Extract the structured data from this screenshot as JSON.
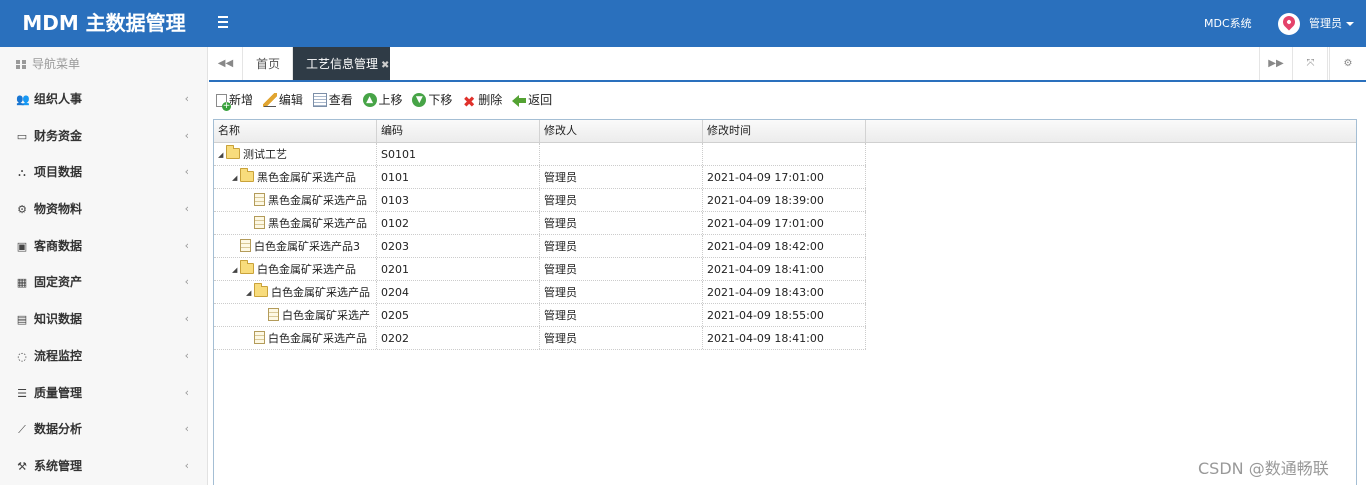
{
  "app": {
    "title": "MDM 主数据管理"
  },
  "header": {
    "system_link": "MDC系统",
    "user_name": "管理员"
  },
  "sidebar": {
    "title": "导航菜单",
    "items": [
      {
        "label": "组织人事",
        "icon": "users-icon",
        "glyph": "👥"
      },
      {
        "label": "财务资金",
        "icon": "credit-card-icon",
        "glyph": "▭"
      },
      {
        "label": "项目数据",
        "icon": "sitemap-icon",
        "glyph": "⛬"
      },
      {
        "label": "物资物料",
        "icon": "cubes-icon",
        "glyph": "⚙"
      },
      {
        "label": "客商数据",
        "icon": "briefcase-icon",
        "glyph": "▣"
      },
      {
        "label": "固定资产",
        "icon": "building-icon",
        "glyph": "▦"
      },
      {
        "label": "知识数据",
        "icon": "document-icon",
        "glyph": "▤"
      },
      {
        "label": "流程监控",
        "icon": "spinner-icon",
        "glyph": "◌"
      },
      {
        "label": "质量管理",
        "icon": "list-alt-icon",
        "glyph": "☰"
      },
      {
        "label": "数据分析",
        "icon": "line-chart-icon",
        "glyph": "⟋"
      },
      {
        "label": "系统管理",
        "icon": "wrench-icon",
        "glyph": "⚒"
      }
    ]
  },
  "tabs": {
    "home": "首页",
    "active": "工艺信息管理"
  },
  "toolbar": {
    "new": "新增",
    "edit": "编辑",
    "view": "查看",
    "up": "上移",
    "down": "下移",
    "delete": "删除",
    "back": "返回"
  },
  "grid": {
    "columns": [
      "名称",
      "编码",
      "修改人",
      "修改时间"
    ],
    "rows": [
      {
        "name": "测试工艺",
        "code": "S0101",
        "modifier": "",
        "time": ""
      },
      {
        "name": "黑色金属矿采选产品",
        "code": "0101",
        "modifier": "管理员",
        "time": "2021-04-09 17:01:00"
      },
      {
        "name": "黑色金属矿采选产品",
        "code": "0103",
        "modifier": "管理员",
        "time": "2021-04-09 18:39:00"
      },
      {
        "name": "黑色金属矿采选产品",
        "code": "0102",
        "modifier": "管理员",
        "time": "2021-04-09 17:01:00"
      },
      {
        "name": "白色金属矿采选产品3",
        "code": "0203",
        "modifier": "管理员",
        "time": "2021-04-09 18:42:00"
      },
      {
        "name": "白色金属矿采选产品",
        "code": "0201",
        "modifier": "管理员",
        "time": "2021-04-09 18:41:00"
      },
      {
        "name": "白色金属矿采选产品",
        "code": "0204",
        "modifier": "管理员",
        "time": "2021-04-09 18:43:00"
      },
      {
        "name": "白色金属矿采选产",
        "code": "0205",
        "modifier": "管理员",
        "time": "2021-04-09 18:55:00"
      },
      {
        "name": "白色金属矿采选产品",
        "code": "0202",
        "modifier": "管理员",
        "time": "2021-04-09 18:41:00"
      }
    ]
  },
  "watermark": "CSDN @数通畅联"
}
